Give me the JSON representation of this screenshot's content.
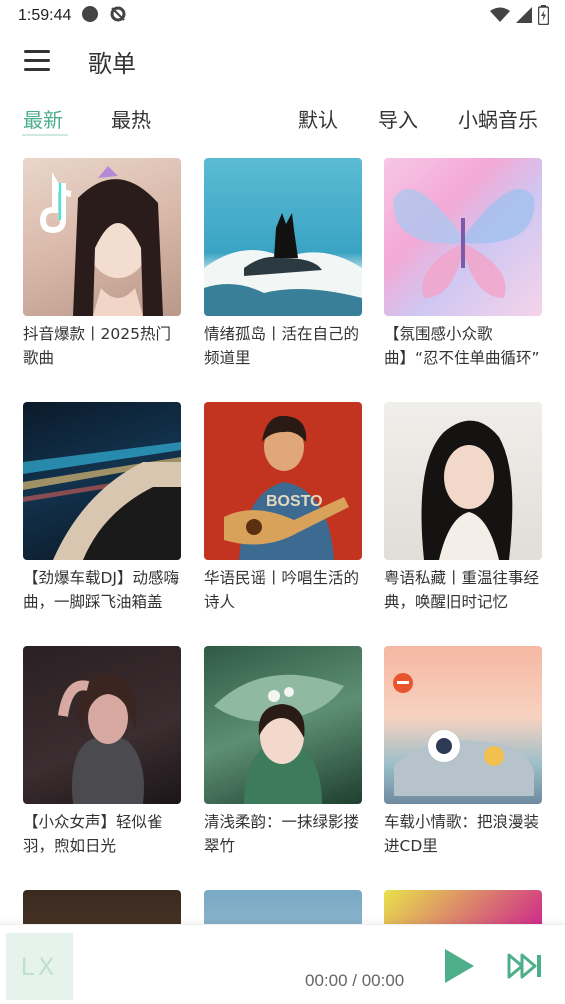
{
  "status_bar": {
    "time": "1:59:44"
  },
  "app_bar": {
    "title": "歌单",
    "menu_icon": "hamburger-icon"
  },
  "tabs": {
    "sort": [
      {
        "label": "最新",
        "active": true
      },
      {
        "label": "最热",
        "active": false
      }
    ],
    "actions": [
      {
        "label": "默认"
      },
      {
        "label": "导入"
      },
      {
        "label": "小蜗音乐"
      }
    ]
  },
  "playlists": [
    {
      "title": "抖音爆款丨2025热门歌曲"
    },
    {
      "title": "情绪孤岛丨活在自己的频道里"
    },
    {
      "title": "【氛围感小众歌曲】“忍不住单曲循环”"
    },
    {
      "title": "【劲爆车载DJ】动感嗨曲，一脚踩飞油箱盖"
    },
    {
      "title": "华语民谣丨吟唱生活的诗人"
    },
    {
      "title": "粤语私藏丨重温往事经典，唤醒旧时记忆"
    },
    {
      "title": "【小众女声】轻似雀羽，煦如日光"
    },
    {
      "title": "清浅柔韵：一抹绿影搂翠竹"
    },
    {
      "title": "车载小情歌：把浪漫装进CD里"
    }
  ],
  "player": {
    "logo": "LX",
    "time": "00:00 / 00:00",
    "accent_color": "#4caf8a"
  }
}
